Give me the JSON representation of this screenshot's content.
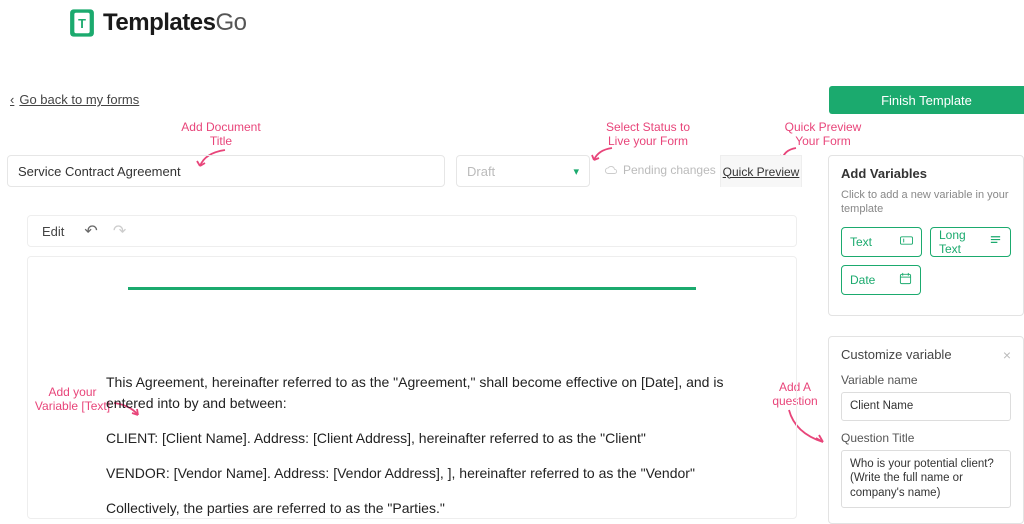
{
  "logo": {
    "brand_a": "Templates",
    "brand_b": "Go"
  },
  "back_link": "Go back to my forms",
  "finish_button": "Finish Template",
  "annotations": {
    "title": "Add Document\nTitle",
    "status": "Select Status to\nLive your Form",
    "preview": "Quick Preview\nYour Form",
    "variable": "Add your\nVariable [Text]",
    "question": "Add A\nquestion"
  },
  "title_input": "Service Contract Agreement",
  "status_select": "Draft",
  "pending": "Pending changes",
  "quick_preview": "Quick Preview",
  "edit": {
    "label": "Edit"
  },
  "document": {
    "p1": "This Agreement, hereinafter referred to as the \"Agreement,\" shall become effective on [Date], and is entered into by and between:",
    "p2": "CLIENT: [Client Name]. Address: [Client Address], hereinafter referred to as the \"Client\"",
    "p3": "VENDOR: [Vendor Name]. Address: [Vendor Address], ], hereinafter referred to as the \"Vendor\"",
    "p4": "Collectively, the parties are referred to as the \"Parties.\""
  },
  "sidebar": {
    "add_variables_title": "Add Variables",
    "add_variables_hint": "Click to add a new variable in your template",
    "btn_text": "Text",
    "btn_longtext": "Long Text",
    "btn_date": "Date",
    "customize_title": "Customize variable",
    "var_name_label": "Variable name",
    "var_name_value": "Client Name",
    "question_label": "Question Title",
    "question_value": "Who is your potential client? (Write the full name or company's name)"
  }
}
